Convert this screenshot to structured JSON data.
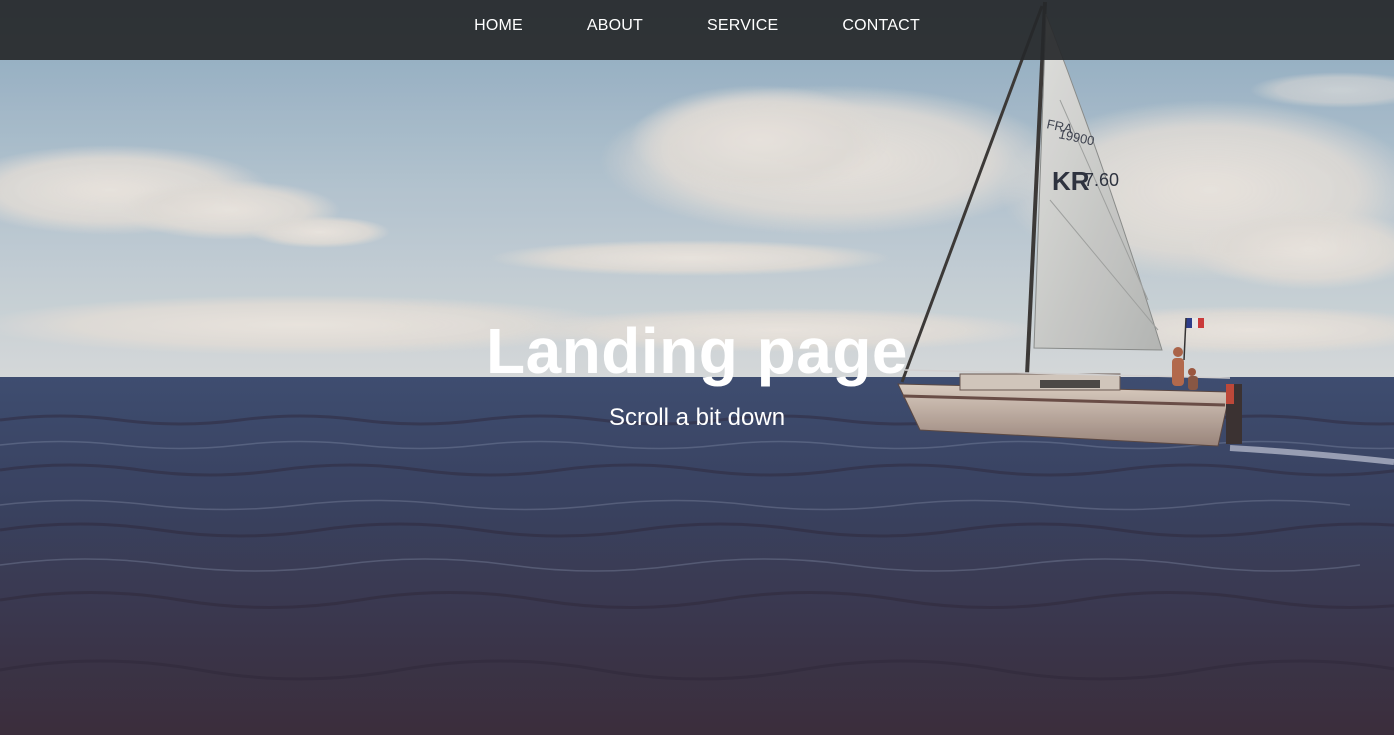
{
  "nav": {
    "items": [
      {
        "label": "HOME"
      },
      {
        "label": "ABOUT"
      },
      {
        "label": "SERVICE"
      },
      {
        "label": "CONTACT"
      }
    ]
  },
  "hero": {
    "title": "Landing page",
    "subtitle": "Scroll a bit down",
    "background": "sailboat-at-sea-photo",
    "sail_marks": [
      "FRA",
      "19900",
      "KR",
      "7.60"
    ]
  },
  "colors": {
    "nav_bg": "#26282a",
    "sky_top": "#9ab8cf",
    "sky_bottom": "#d9e2e6",
    "sea_top": "#3a4a6c",
    "sea_bottom": "#3b2f3e",
    "text": "#ffffff"
  }
}
